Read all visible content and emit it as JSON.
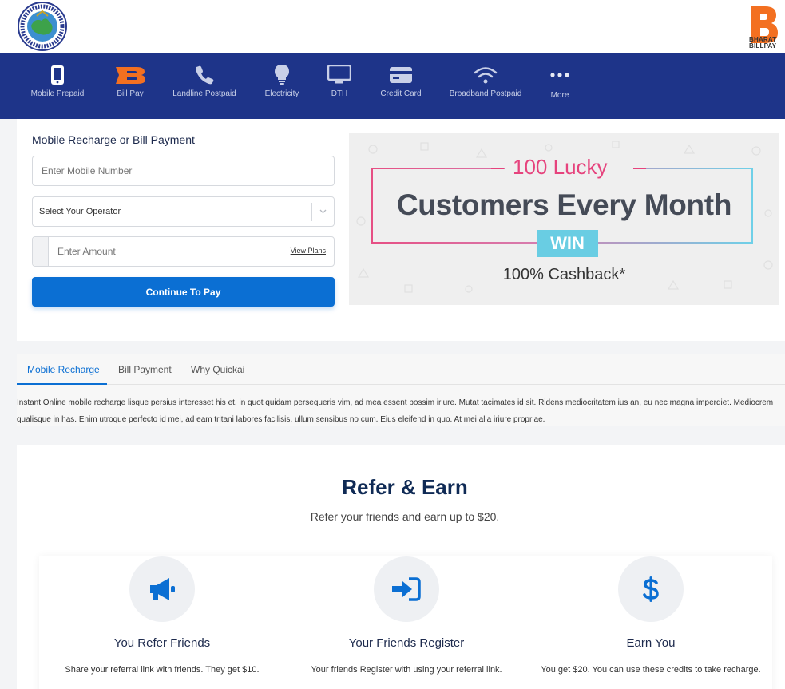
{
  "nav": {
    "items": [
      {
        "label": "Mobile Prepaid",
        "icon": "mobile-phone-icon"
      },
      {
        "label": "Bill Pay",
        "icon": "bharat-billpay-b-icon"
      },
      {
        "label": "Landline Postpaid",
        "icon": "telephone-icon"
      },
      {
        "label": "Electricity",
        "icon": "lightbulb-icon"
      },
      {
        "label": "DTH",
        "icon": "tv-monitor-icon"
      },
      {
        "label": "Credit Card",
        "icon": "credit-card-icon"
      },
      {
        "label": "Broadband Postpaid",
        "icon": "wifi-icon"
      },
      {
        "label": "More",
        "icon": "ellipsis-icon"
      }
    ]
  },
  "brand": {
    "bbps_line1": "BHARAT",
    "bbps_line2": "BILLPAY",
    "bbps_color": "#f37021",
    "nav_color": "#1e3489"
  },
  "recharge": {
    "title": "Mobile Recharge or Bill Payment",
    "mobile_placeholder": "Enter Mobile Number",
    "operator_value": "Select Your Operator",
    "amount_placeholder": "Enter Amount",
    "view_plans": "View Plans",
    "continue_label": "Continue To Pay",
    "button_color": "#0b6fd3"
  },
  "banner": {
    "lucky": "100 Lucky",
    "headline": "Customers Every Month",
    "win": "WIN",
    "cashback": "100% Cashback*"
  },
  "tabs": {
    "items": [
      "Mobile Recharge",
      "Bill Payment",
      "Why Quickai"
    ],
    "active": "Mobile Recharge",
    "content": "Instant Online mobile recharge lisque persius interesset his et, in quot quidam persequeris vim, ad mea essent possim iriure. Mutat tacimates id sit. Ridens mediocritatem ius an, eu nec magna imperdiet. Mediocrem qualisque in has. Enim utroque perfecto id mei, ad eam tritani labores facilisis, ullum sensibus no cum. Eius eleifend in quo. At mei alia iriure propriae."
  },
  "refer": {
    "title": "Refer & Earn",
    "subtitle": "Refer your friends and earn up to $20.",
    "steps": [
      {
        "title": "You Refer Friends",
        "desc": "Share your referral link with friends. They get $10.",
        "icon": "megaphone-icon"
      },
      {
        "title": "Your Friends Register",
        "desc": "Your friends Register with using your referral link.",
        "icon": "sign-in-icon"
      },
      {
        "title": "Earn You",
        "desc": "You get $20. You can use these credits to take recharge.",
        "icon": "dollar-icon"
      }
    ]
  }
}
